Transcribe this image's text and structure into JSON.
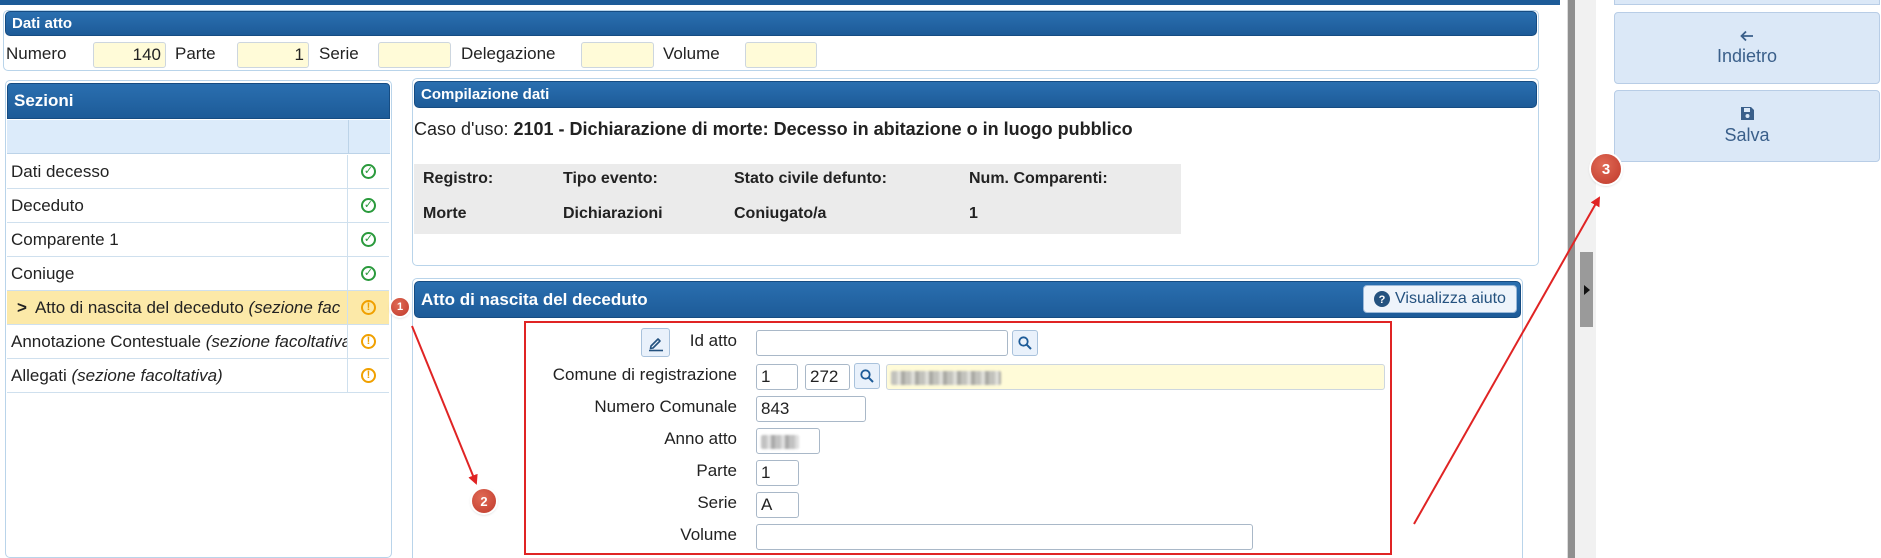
{
  "dati_atto": {
    "title": "Dati atto",
    "numero_label": "Numero",
    "numero_value": "140",
    "parte_label": "Parte",
    "parte_value": "1",
    "serie_label": "Serie",
    "serie_value": "",
    "delegazione_label": "Delegazione",
    "delegazione_value": "",
    "volume_label": "Volume",
    "volume_value": ""
  },
  "sezioni": {
    "title": "Sezioni",
    "items": [
      {
        "label": "Dati decesso",
        "optional": "",
        "status": "ok"
      },
      {
        "label": "Deceduto",
        "optional": "",
        "status": "ok"
      },
      {
        "label": "Comparente 1",
        "optional": "",
        "status": "ok"
      },
      {
        "label": "Coniuge",
        "optional": "",
        "status": "ok"
      },
      {
        "label": "Atto di nascita del deceduto",
        "optional": "(sezione fac",
        "status": "warn",
        "prefix": ">"
      },
      {
        "label": "Annotazione Contestuale",
        "optional": "(sezione facoltativa",
        "status": "warn"
      },
      {
        "label": "Allegati",
        "optional": "(sezione facoltativa)",
        "status": "warn"
      }
    ],
    "status_ok_glyph": "✓",
    "status_warn_glyph": "!"
  },
  "compilazione": {
    "title": "Compilazione dati",
    "caso_label": "Caso d'uso:",
    "caso_value": "2101 - Dichiarazione di morte: Decesso in abitazione o in luogo pubblico",
    "headers": [
      "Registro:",
      "Tipo evento:",
      "Stato civile defunto:",
      "Num. Comparenti:"
    ],
    "values": [
      "Morte",
      "Dichiarazioni",
      "Coniugato/a",
      "1"
    ]
  },
  "atto_nascita": {
    "title": "Atto di nascita del deceduto",
    "help_label": "Visualizza aiuto",
    "id_atto_label": "Id atto",
    "id_atto_value": "",
    "comune_label": "Comune di registrazione",
    "comune_code1": "1",
    "comune_code2": "272",
    "numero_comunale_label": "Numero Comunale",
    "numero_comunale_value": "843",
    "anno_label": "Anno atto",
    "parte_label": "Parte",
    "parte_value": "1",
    "serie_label": "Serie",
    "serie_value": "A",
    "volume_label": "Volume",
    "volume_value": ""
  },
  "sidebar": {
    "indietro_label": "Indietro",
    "salva_label": "Salva"
  },
  "annotations": {
    "badge1": "1",
    "badge2": "2",
    "badge3": "3",
    "color": "#e02424"
  },
  "icons": {
    "search": "search-icon",
    "edit": "edit-icon",
    "back": "arrow-left-icon",
    "save": "floppy-disk-icon",
    "help": "question-circle-icon",
    "expand": "caret-right-icon"
  }
}
